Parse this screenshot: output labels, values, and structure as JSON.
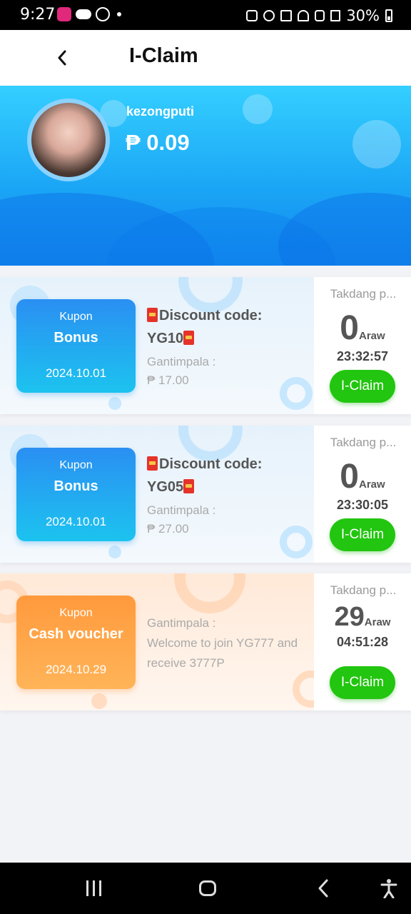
{
  "status_bar": {
    "time": "9:27",
    "battery": "30%"
  },
  "header": {
    "title": "I-Claim"
  },
  "profile": {
    "username": "kezongputi",
    "balance": "₱ 0.09"
  },
  "colors": {
    "hero_blue": "#1aa3f5",
    "claim_green": "#22c50f",
    "coupon_blue": "#2a8ff2",
    "coupon_orange": "#ff9a3d"
  },
  "cards": [
    {
      "kupon_label": "Kupon",
      "type": "Bonus",
      "date": "2024.10.01",
      "code_label": "Discount code:",
      "code": "YG10",
      "prize_label": "Gantimpala :",
      "prize_value": "₱ 17.00",
      "remain_label": "Takdang p...",
      "days": "0",
      "days_unit": "Araw",
      "countdown": "23:32:57",
      "button_label": "I-Claim"
    },
    {
      "kupon_label": "Kupon",
      "type": "Bonus",
      "date": "2024.10.01",
      "code_label": "Discount code:",
      "code": "YG05",
      "prize_label": "Gantimpala :",
      "prize_value": "₱ 27.00",
      "remain_label": "Takdang p...",
      "days": "0",
      "days_unit": "Araw",
      "countdown": "23:30:05",
      "button_label": "I-Claim"
    },
    {
      "kupon_label": "Kupon",
      "type": "Cash voucher",
      "date": "2024.10.29",
      "prize_label": "Gantimpala :",
      "prize_text": "Welcome to join YG777 and receive 3777P",
      "remain_label": "Takdang p...",
      "days": "29",
      "days_unit": "Araw",
      "countdown": "04:51:28",
      "button_label": "I-Claim"
    }
  ],
  "nav_icons": [
    "recents-icon",
    "home-icon",
    "back-icon",
    "accessibility-icon"
  ]
}
